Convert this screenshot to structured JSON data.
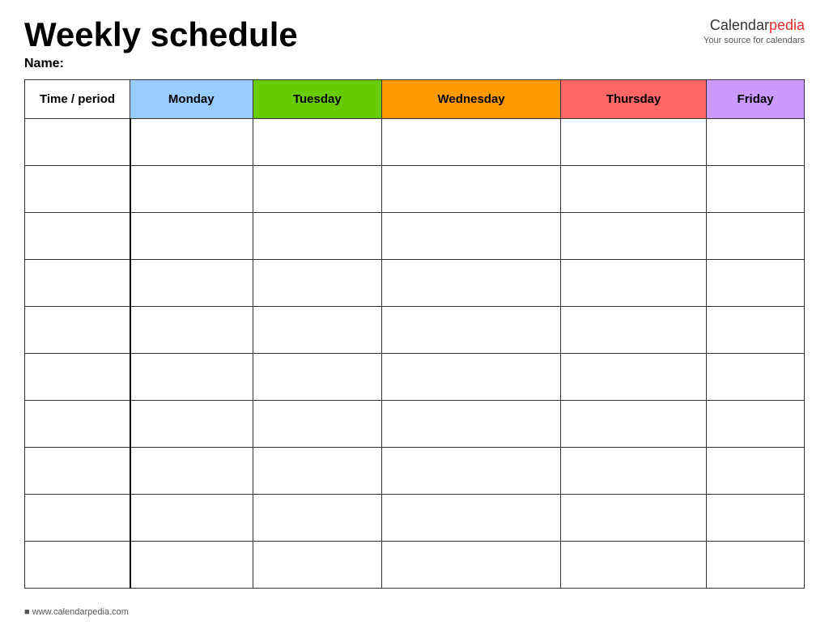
{
  "header": {
    "title": "Weekly schedule",
    "name_label": "Name:",
    "brand": {
      "name_part1": "Calendar",
      "name_part2": "pedia",
      "tagline": "Your source for calendars"
    }
  },
  "table": {
    "columns": [
      {
        "label": "Time / period",
        "class": "th-time"
      },
      {
        "label": "Monday",
        "class": "th-monday"
      },
      {
        "label": "Tuesday",
        "class": "th-tuesday"
      },
      {
        "label": "Wednesday",
        "class": "th-wednesday"
      },
      {
        "label": "Thursday",
        "class": "th-thursday"
      },
      {
        "label": "Friday",
        "class": "th-friday"
      }
    ],
    "row_count": 10
  },
  "footer": {
    "url": "www.calendarpedia.com"
  }
}
